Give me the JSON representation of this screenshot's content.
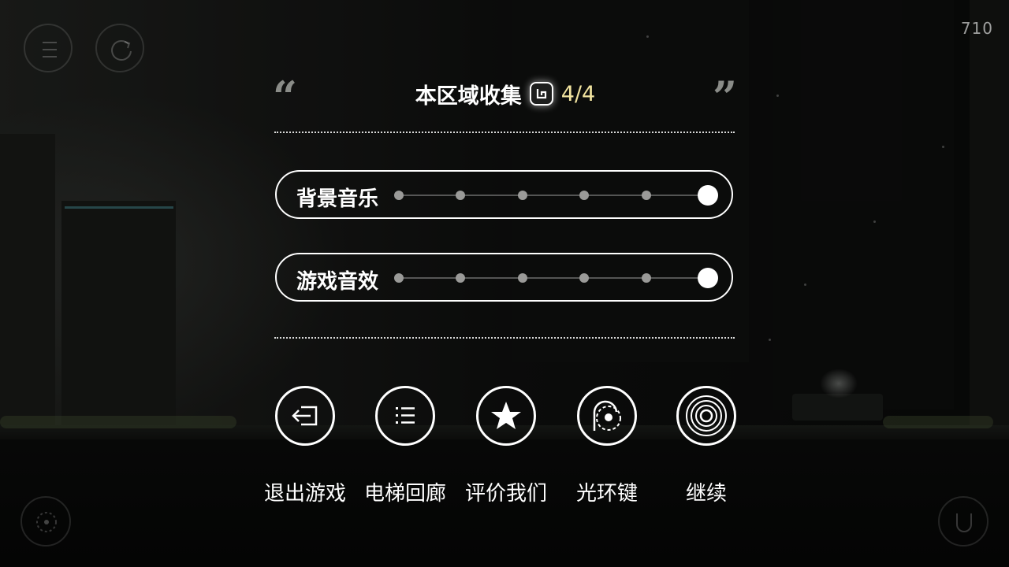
{
  "hud": {
    "counter": "710",
    "top_left_buttons": [
      {
        "icon": "menu-icon"
      },
      {
        "icon": "restart-icon"
      }
    ],
    "bottom_left_button": {
      "icon": "target-icon"
    },
    "bottom_right_button": {
      "icon": "u-shape-icon"
    }
  },
  "panel": {
    "quote_open": "“",
    "quote_close": "”",
    "collection_label": "本区域收集",
    "collection_icon": "spiral-collectible-icon",
    "collection_count": "4/4",
    "sliders": [
      {
        "label": "背景音乐",
        "steps": 6,
        "level_fraction": 1.0
      },
      {
        "label": "游戏音效",
        "steps": 6,
        "level_fraction": 1.0
      }
    ],
    "actions": [
      {
        "label": "退出游戏",
        "icon": "exit-icon"
      },
      {
        "label": "电梯回廊",
        "icon": "list-icon"
      },
      {
        "label": "评价我们",
        "icon": "star-icon"
      },
      {
        "label": "光环键",
        "icon": "halo-key-icon"
      },
      {
        "label": "继续",
        "icon": "concentric-rings-icon"
      }
    ]
  },
  "colors": {
    "accent_count": "#f2e4a0",
    "panel_line": "#ffffff",
    "slider_inactive": "#9a9a98"
  }
}
